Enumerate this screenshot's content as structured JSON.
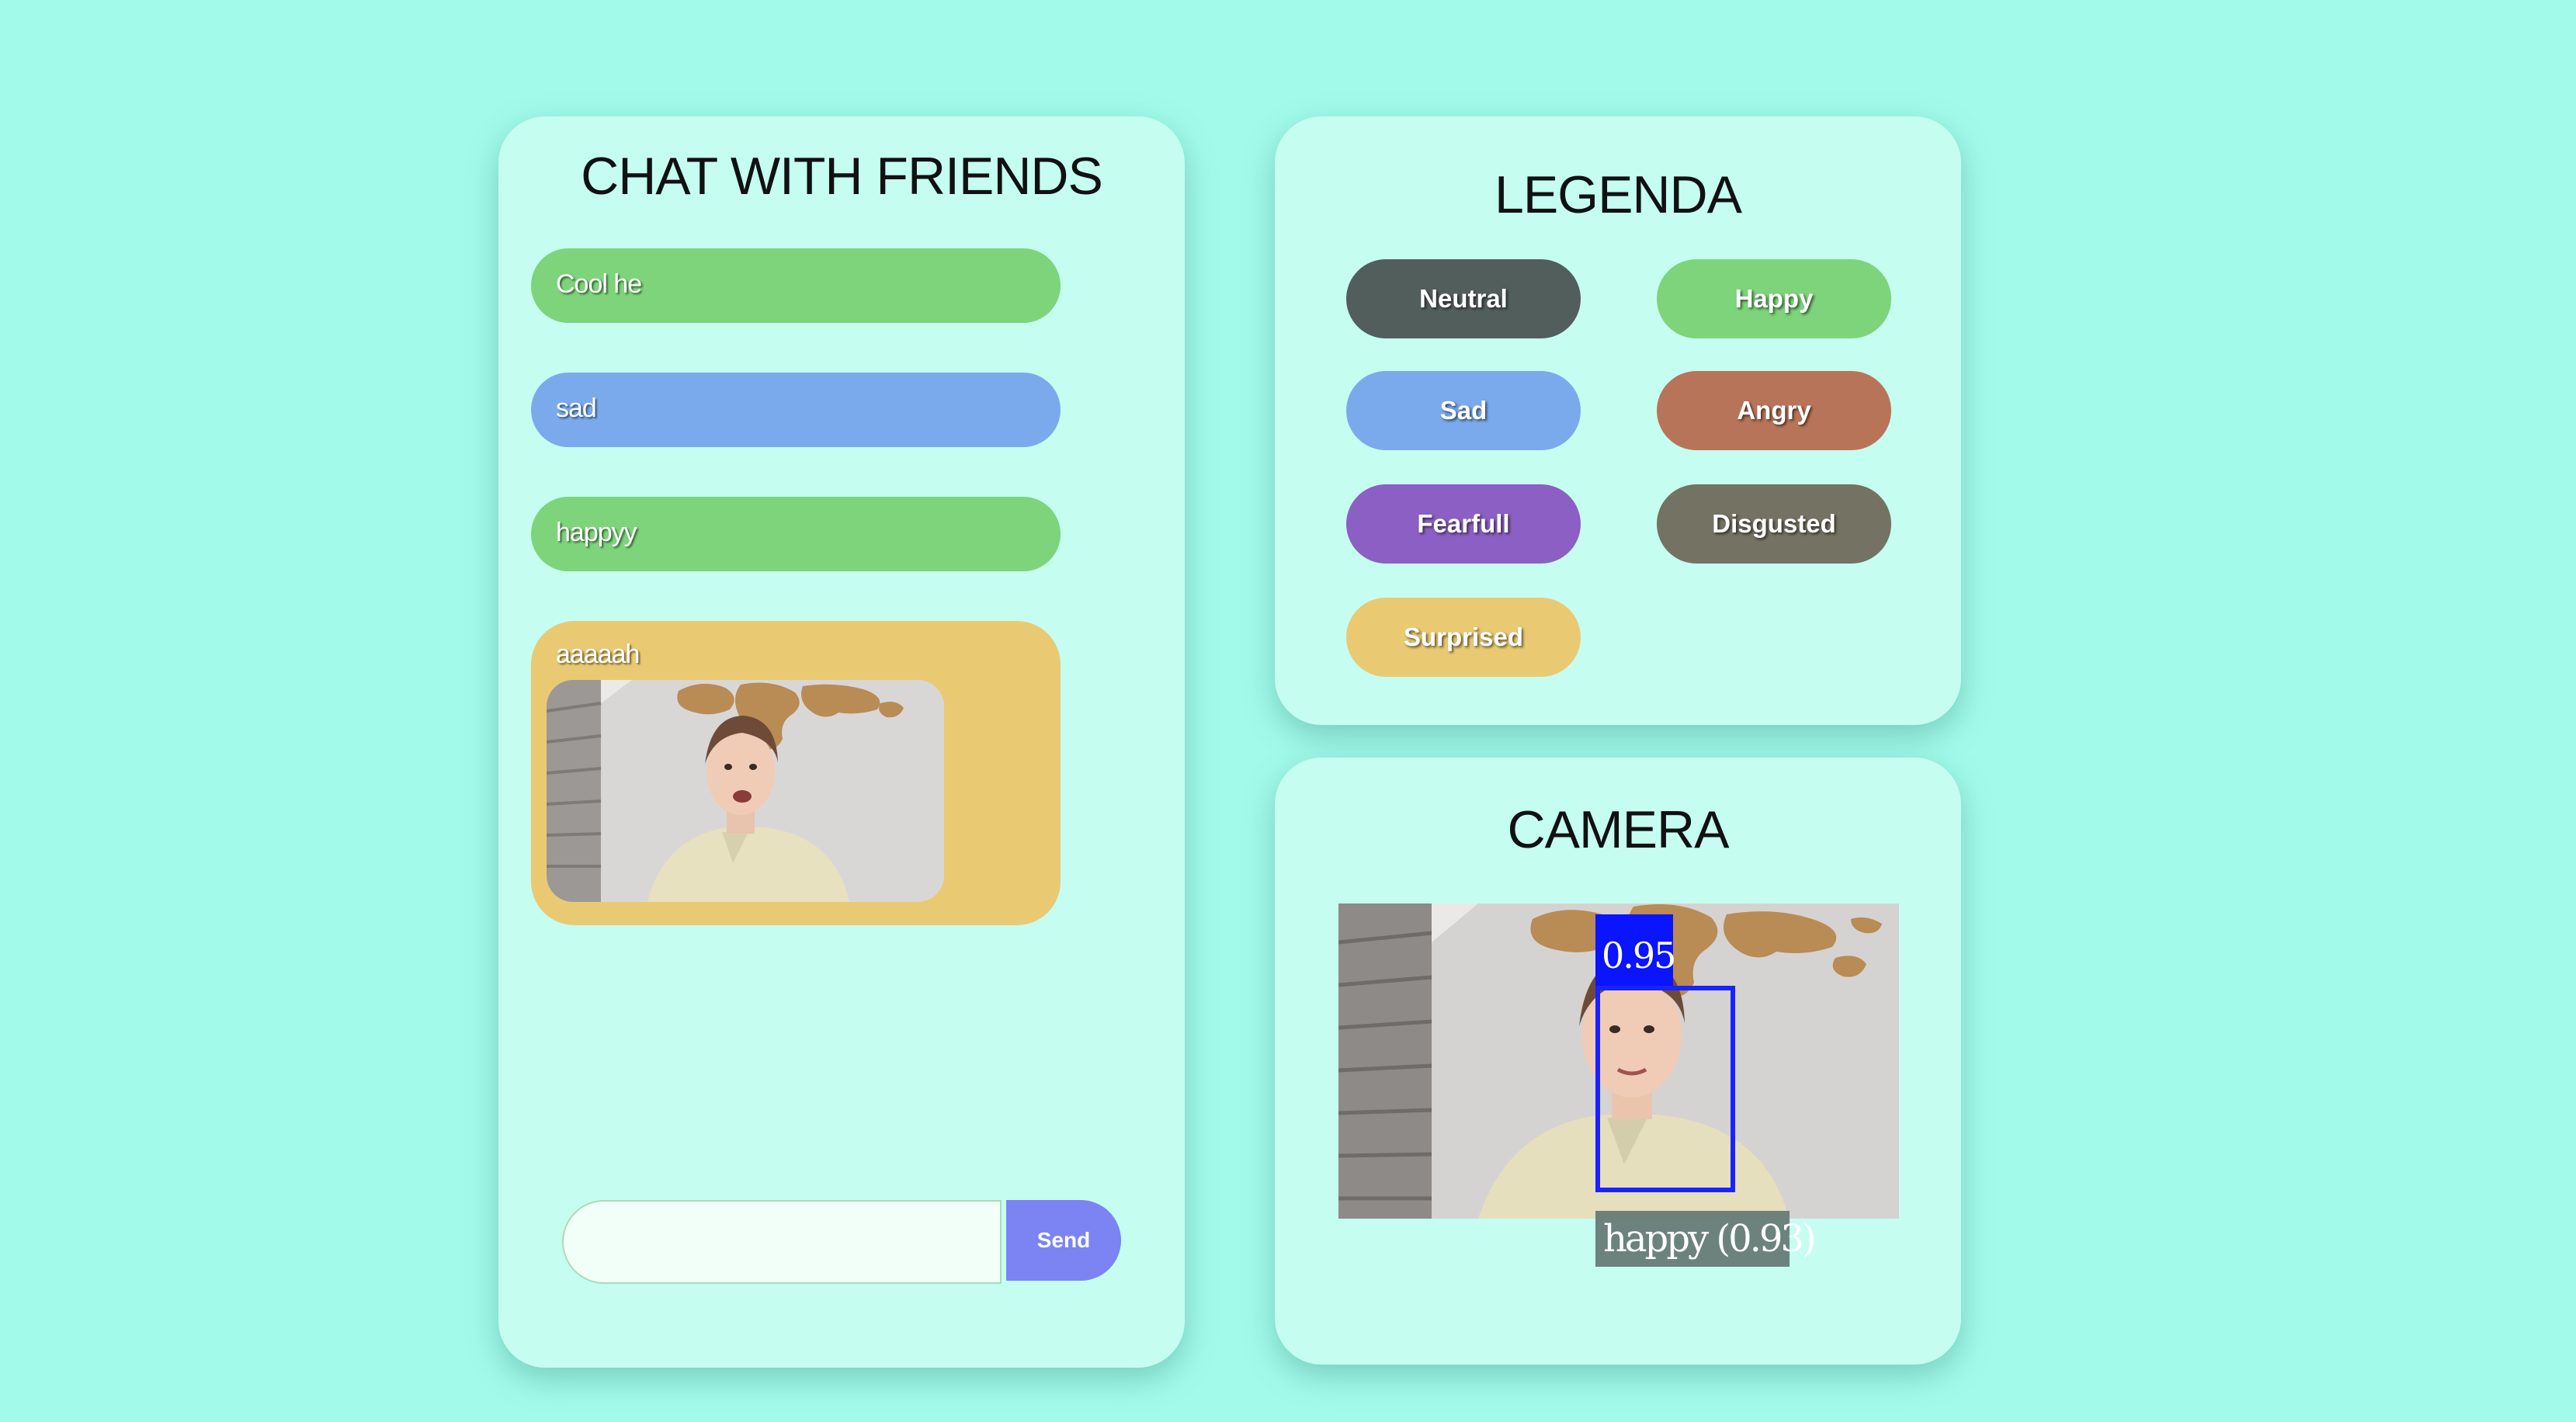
{
  "chat": {
    "title": "CHAT WITH FRIENDS",
    "messages": [
      {
        "text": "Cool he",
        "emotion": "Happy"
      },
      {
        "text": "sad",
        "emotion": "Sad"
      },
      {
        "text": "happyy",
        "emotion": "Happy"
      },
      {
        "text": "aaaaah",
        "emotion": "Surprised",
        "has_snapshot": true
      }
    ],
    "input_value": "",
    "send_label": "Send"
  },
  "legend": {
    "title": "LEGENDA",
    "items": [
      {
        "label": "Neutral",
        "color": "#525e5c"
      },
      {
        "label": "Happy",
        "color": "#7dd47b"
      },
      {
        "label": "Sad",
        "color": "#7aaaec"
      },
      {
        "label": "Angry",
        "color": "#b87459"
      },
      {
        "label": "Fearfull",
        "color": "#8b5fc3"
      },
      {
        "label": "Disgusted",
        "color": "#747262"
      },
      {
        "label": "Surprised",
        "color": "#e9ca73"
      }
    ]
  },
  "camera": {
    "title": "CAMERA",
    "detection": {
      "score": "0.95",
      "label": "happy (0.93)"
    }
  },
  "colors": {
    "background": "#a2fbea",
    "panel": "#c6fdf1",
    "send_button": "#7b84f2",
    "detection_box": "#1a22ff"
  }
}
